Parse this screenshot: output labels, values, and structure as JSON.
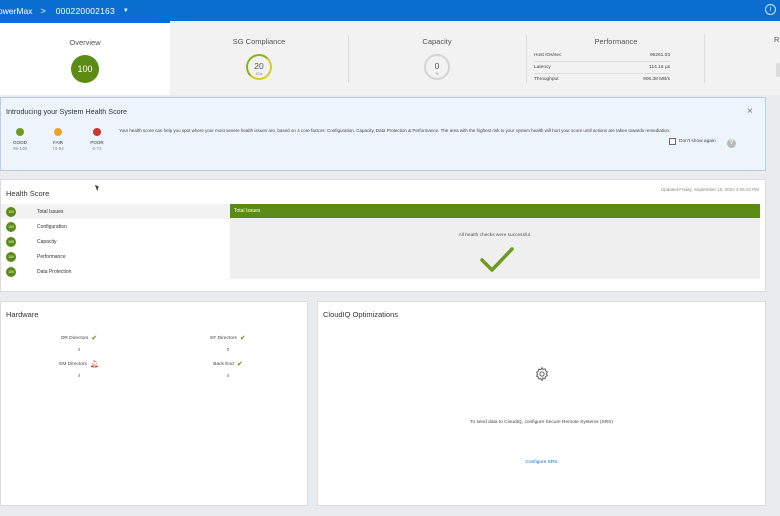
{
  "topbar": {
    "app_name": "owerMax",
    "separator": ">",
    "system_id": "000220002163",
    "info_icon": "i"
  },
  "summary": {
    "overview": {
      "title": "Overview",
      "score": "100"
    },
    "sg_compliance": {
      "title": "SG Compliance",
      "value": "20",
      "sub": "SGs"
    },
    "capacity": {
      "title": "Capacity",
      "value": "0",
      "sub": "%"
    },
    "performance": {
      "title": "Performance",
      "rows": [
        {
          "label": "Host IOs/sec",
          "value": "96261.03"
        },
        {
          "label": "Latency",
          "value": "114.16 μs"
        },
        {
          "label": "Throughput",
          "value": "906.38 MB/s"
        }
      ]
    },
    "next_tile_peek": "R"
  },
  "intro": {
    "title": "Introducing your System Health Score",
    "close": "×",
    "legend": [
      {
        "label": "GOOD",
        "range": "95-100",
        "color": "#6e9a1f"
      },
      {
        "label": "FAIR",
        "range": "74-94",
        "color": "#f0a32a"
      },
      {
        "label": "POOR",
        "range": "0-73",
        "color": "#d0342c"
      }
    ],
    "description": "Your health score can help you spot where your most severe health issues are, based on 4 core factors: Configuration, Capacity, Data Protection & Performance. The area with the highest risk to your system health will hurt your score until actions are taken towards remediation.",
    "dont_show": "Don't show again",
    "help": "?"
  },
  "health": {
    "title": "Health Score",
    "updated": "Updated Friday, September 15, 2023 4:05:22 PM",
    "items": [
      {
        "score": "100",
        "label": "Total Issues"
      },
      {
        "score": "100",
        "label": "Configuration"
      },
      {
        "score": "100",
        "label": "Capacity"
      },
      {
        "score": "100",
        "label": "Performance"
      },
      {
        "score": "100",
        "label": "Data Protection"
      }
    ],
    "detail_header": "Total Issues",
    "detail_message": "All health checks were successful."
  },
  "hardware": {
    "title": "Hardware",
    "items": [
      {
        "label": "OR Directors",
        "value": "4",
        "status_icon": "check-icon"
      },
      {
        "label": "EF Directors",
        "value": "0",
        "status_icon": "check-icon"
      },
      {
        "label": "EM Directors",
        "value": "4",
        "status_icon": "bell-alert-icon"
      },
      {
        "label": "Back End",
        "value": "4",
        "status_icon": "check-icon"
      }
    ]
  },
  "cloudiq": {
    "title": "CloudIQ Optimizations",
    "message": "To send data to CloudIQ, configure Secure Remote Systems (SRS)",
    "link": "Configure SRS"
  }
}
